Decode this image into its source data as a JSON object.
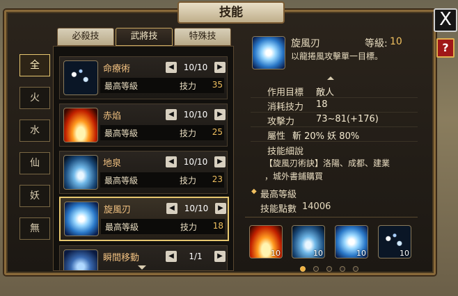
{
  "window": {
    "title": "技能"
  },
  "buttons": {
    "close": "X",
    "help": "?"
  },
  "tabs": [
    {
      "label": "必殺技",
      "active": false
    },
    {
      "label": "武將技",
      "active": true
    },
    {
      "label": "特殊技",
      "active": false
    }
  ],
  "filters": [
    {
      "label": "全",
      "active": true
    },
    {
      "label": "火",
      "active": false
    },
    {
      "label": "水",
      "active": false
    },
    {
      "label": "仙",
      "active": false
    },
    {
      "label": "妖",
      "active": false
    },
    {
      "label": "無",
      "active": false
    }
  ],
  "skills": [
    {
      "name": "命療術",
      "level": "10/10",
      "max_label": "最高等級",
      "cost_label": "技力",
      "cost": "35",
      "icon": "heal-icon",
      "selected": false
    },
    {
      "name": "赤焰",
      "level": "10/10",
      "max_label": "最高等級",
      "cost_label": "技力",
      "cost": "25",
      "icon": "fire-icon",
      "selected": false
    },
    {
      "name": "地泉",
      "level": "10/10",
      "max_label": "最高等級",
      "cost_label": "技力",
      "cost": "23",
      "icon": "spring-icon",
      "selected": false
    },
    {
      "name": "旋風刃",
      "level": "10/10",
      "max_label": "最高等級",
      "cost_label": "技力",
      "cost": "18",
      "icon": "whirlwind-icon",
      "selected": true
    },
    {
      "name": "瞬間移動",
      "level": "1/1",
      "max_label": "",
      "cost_label": "",
      "cost": "",
      "icon": "teleport-icon",
      "selected": false
    }
  ],
  "detail": {
    "name": "旋風刃",
    "level_label": "等級:",
    "level_value": "10",
    "summary": "以龍捲風攻擊單一目標。",
    "target_label": "作用目標",
    "target_value": "敵人",
    "cost_label": "消耗技力",
    "cost_value": "18",
    "attack_label": "攻擊力",
    "attack_value": "73~81(+176)",
    "attr_label": "屬性",
    "attr_value": "斬 20%  妖 80%",
    "desc_label": "技能細說",
    "desc_line1": "【旋風刃術訣】洛陽、成都、建業",
    "desc_line2": "，城外書鋪購買",
    "max_level_label": "最高等級",
    "points_label": "技能點數",
    "points_value": "14006"
  },
  "bottom_slots": [
    {
      "icon": "fire-icon",
      "level": "10"
    },
    {
      "icon": "spring-icon",
      "level": "10"
    },
    {
      "icon": "whirlwind-icon",
      "level": "10"
    },
    {
      "icon": "heal-icon",
      "level": "10"
    }
  ],
  "pager": {
    "pages": 5,
    "current": 1
  },
  "colors": {
    "accent": "#f0c060",
    "frame": "#8a6a3a",
    "selected_border": "#e8c870"
  }
}
